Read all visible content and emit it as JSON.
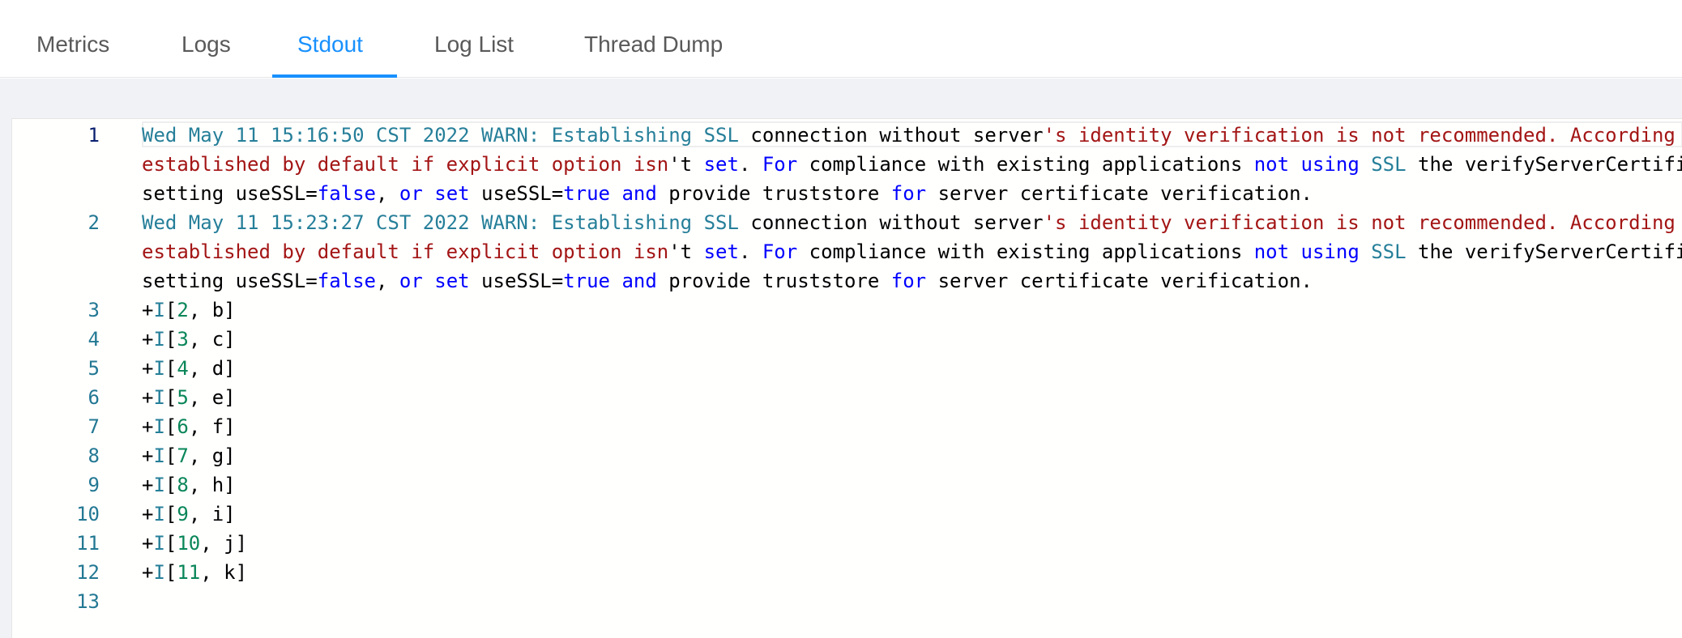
{
  "tabs": [
    {
      "label": "Metrics",
      "active": false
    },
    {
      "label": "Logs",
      "active": false
    },
    {
      "label": "Stdout",
      "active": true
    },
    {
      "label": "Log List",
      "active": false
    },
    {
      "label": "Thread Dump",
      "active": false
    }
  ],
  "colors": {
    "accent": "#1890ff",
    "line_number": "#237893",
    "keyword": "#0000ff",
    "string": "#a31515",
    "number": "#098658",
    "type": "#267f99"
  },
  "editor": {
    "lines": [
      {
        "number": "1",
        "rows": [
          [
            [
              "Wed May 11 15:16:50 CST 2022 WARN:",
              "type"
            ],
            [
              " ",
              "def"
            ],
            [
              "Establishing SSL",
              "type"
            ],
            [
              " connection without server",
              "def"
            ],
            [
              "'s identity verification is not recommended. According",
              "str"
            ]
          ],
          [
            [
              "established by default if explicit option isn",
              "str"
            ],
            [
              "'t ",
              "def"
            ],
            [
              "set",
              "kw"
            ],
            [
              ". ",
              "def"
            ],
            [
              "For",
              "kw"
            ],
            [
              " compliance with existing applications ",
              "def"
            ],
            [
              "not using",
              "kw"
            ],
            [
              " ",
              "def"
            ],
            [
              "SSL",
              "type"
            ],
            [
              " the verifyServerCertifi",
              "def"
            ]
          ],
          [
            [
              "setting useSSL=",
              "def"
            ],
            [
              "false",
              "kw"
            ],
            [
              ", ",
              "def"
            ],
            [
              "or set",
              "kw"
            ],
            [
              " useSSL=",
              "def"
            ],
            [
              "true and",
              "kw"
            ],
            [
              " provide truststore ",
              "def"
            ],
            [
              "for",
              "kw"
            ],
            [
              " server certificate verification.",
              "def"
            ]
          ]
        ]
      },
      {
        "number": "2",
        "rows": [
          [
            [
              "Wed May 11 15:23:27 CST 2022 WARN:",
              "type"
            ],
            [
              " ",
              "def"
            ],
            [
              "Establishing SSL",
              "type"
            ],
            [
              " connection without server",
              "def"
            ],
            [
              "'s identity verification is not recommended. According",
              "str"
            ]
          ],
          [
            [
              "established by default if explicit option isn",
              "str"
            ],
            [
              "'t ",
              "def"
            ],
            [
              "set",
              "kw"
            ],
            [
              ". ",
              "def"
            ],
            [
              "For",
              "kw"
            ],
            [
              " compliance with existing applications ",
              "def"
            ],
            [
              "not using",
              "kw"
            ],
            [
              " ",
              "def"
            ],
            [
              "SSL",
              "type"
            ],
            [
              " the verifyServerCertifi",
              "def"
            ]
          ],
          [
            [
              "setting useSSL=",
              "def"
            ],
            [
              "false",
              "kw"
            ],
            [
              ", ",
              "def"
            ],
            [
              "or set",
              "kw"
            ],
            [
              " useSSL=",
              "def"
            ],
            [
              "true and",
              "kw"
            ],
            [
              " provide truststore ",
              "def"
            ],
            [
              "for",
              "kw"
            ],
            [
              " server certificate verification.",
              "def"
            ]
          ]
        ]
      },
      {
        "number": "3",
        "rows": [
          [
            [
              "+",
              "def"
            ],
            [
              "I",
              "type"
            ],
            [
              "[",
              "def"
            ],
            [
              "2",
              "num"
            ],
            [
              ", b]",
              "def"
            ]
          ]
        ]
      },
      {
        "number": "4",
        "rows": [
          [
            [
              "+",
              "def"
            ],
            [
              "I",
              "type"
            ],
            [
              "[",
              "def"
            ],
            [
              "3",
              "num"
            ],
            [
              ", c]",
              "def"
            ]
          ]
        ]
      },
      {
        "number": "5",
        "rows": [
          [
            [
              "+",
              "def"
            ],
            [
              "I",
              "type"
            ],
            [
              "[",
              "def"
            ],
            [
              "4",
              "num"
            ],
            [
              ", d]",
              "def"
            ]
          ]
        ]
      },
      {
        "number": "6",
        "rows": [
          [
            [
              "+",
              "def"
            ],
            [
              "I",
              "type"
            ],
            [
              "[",
              "def"
            ],
            [
              "5",
              "num"
            ],
            [
              ", e]",
              "def"
            ]
          ]
        ]
      },
      {
        "number": "7",
        "rows": [
          [
            [
              "+",
              "def"
            ],
            [
              "I",
              "type"
            ],
            [
              "[",
              "def"
            ],
            [
              "6",
              "num"
            ],
            [
              ", f]",
              "def"
            ]
          ]
        ]
      },
      {
        "number": "8",
        "rows": [
          [
            [
              "+",
              "def"
            ],
            [
              "I",
              "type"
            ],
            [
              "[",
              "def"
            ],
            [
              "7",
              "num"
            ],
            [
              ", g]",
              "def"
            ]
          ]
        ]
      },
      {
        "number": "9",
        "rows": [
          [
            [
              "+",
              "def"
            ],
            [
              "I",
              "type"
            ],
            [
              "[",
              "def"
            ],
            [
              "8",
              "num"
            ],
            [
              ", h]",
              "def"
            ]
          ]
        ]
      },
      {
        "number": "10",
        "rows": [
          [
            [
              "+",
              "def"
            ],
            [
              "I",
              "type"
            ],
            [
              "[",
              "def"
            ],
            [
              "9",
              "num"
            ],
            [
              ", i]",
              "def"
            ]
          ]
        ]
      },
      {
        "number": "11",
        "rows": [
          [
            [
              "+",
              "def"
            ],
            [
              "I",
              "type"
            ],
            [
              "[",
              "def"
            ],
            [
              "10",
              "num"
            ],
            [
              ", j]",
              "def"
            ]
          ]
        ]
      },
      {
        "number": "12",
        "rows": [
          [
            [
              "+",
              "def"
            ],
            [
              "I",
              "type"
            ],
            [
              "[",
              "def"
            ],
            [
              "11",
              "num"
            ],
            [
              ", k]",
              "def"
            ]
          ]
        ]
      },
      {
        "number": "13",
        "rows": [
          [
            [
              "",
              "def"
            ]
          ]
        ]
      }
    ]
  }
}
